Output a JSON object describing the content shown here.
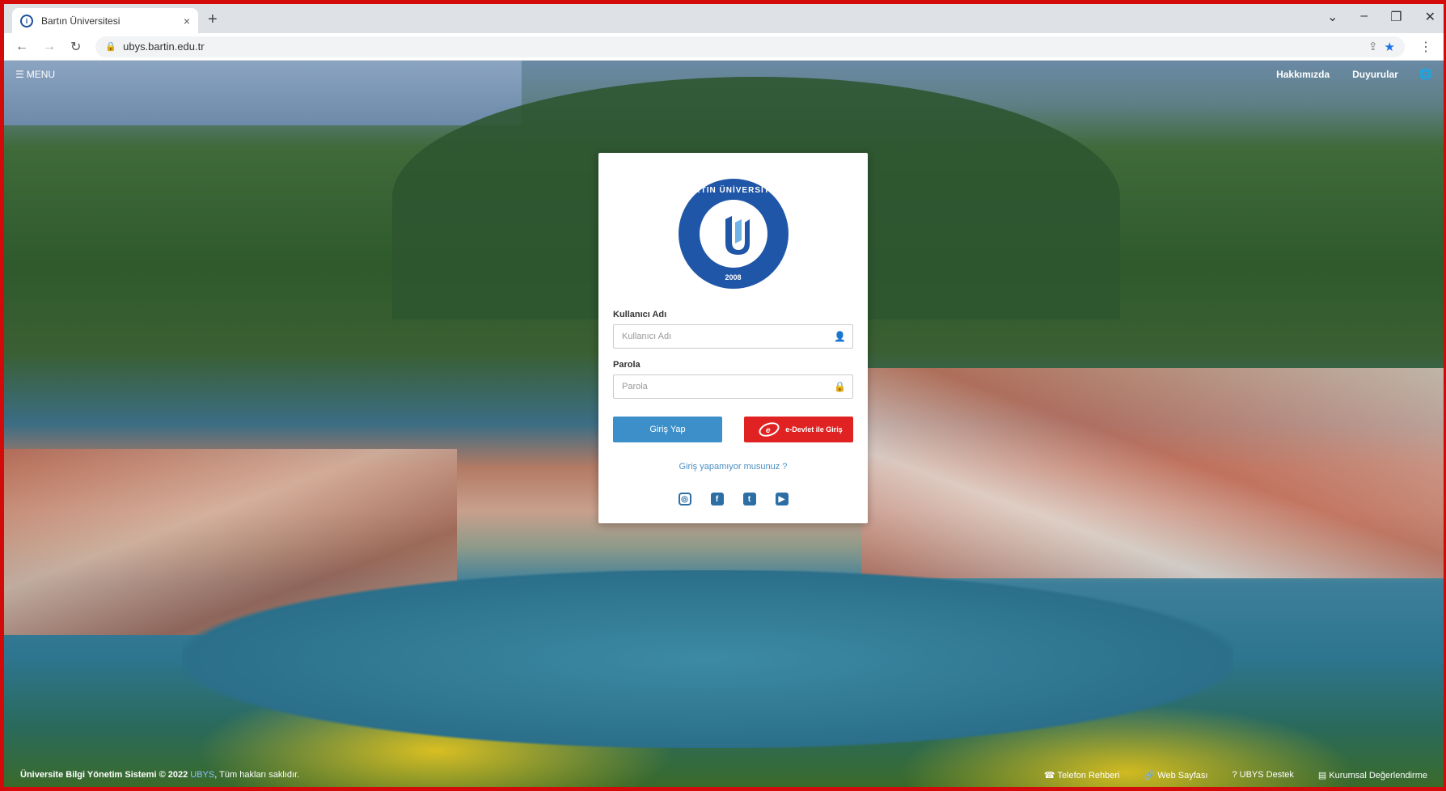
{
  "browser": {
    "tab_title": "Bartın Üniversitesi",
    "tab_close": "×",
    "new_tab": "+",
    "url": "ubys.bartin.edu.tr",
    "window_controls": [
      "⌄",
      "–",
      "❐",
      "✕"
    ]
  },
  "topmenu": {
    "menu_label": "MENU",
    "links": [
      "Hakkımızda",
      "Duyurular"
    ]
  },
  "login": {
    "logo_text": "BARTIN ÜNİVERSİTESİ",
    "logo_year": "2008",
    "username_label": "Kullanıcı Adı",
    "username_placeholder": "Kullanıcı Adı",
    "password_label": "Parola",
    "password_placeholder": "Parola",
    "login_button": "Giriş Yap",
    "edevlet_button": "e-Devlet ile Giriş",
    "forgot_link": "Giriş yapamıyor musunuz ?",
    "socials": [
      "instagram-icon",
      "facebook-icon",
      "twitter-icon",
      "youtube-icon"
    ]
  },
  "footer": {
    "system_name": "Üniversite Bilgi Yönetim Sistemi © 2022",
    "brand": "UBYS",
    "rights": ", Tüm hakları saklıdır.",
    "links": [
      "Telefon Rehberi",
      "Web Sayfası",
      "UBYS Destek",
      "Kurumsal Değerlendirme"
    ]
  },
  "colors": {
    "primary_button": "#3d8fc9",
    "edevlet_button": "#e02222",
    "logo_blue": "#1f56a8",
    "frame_border": "#d20a0a"
  }
}
